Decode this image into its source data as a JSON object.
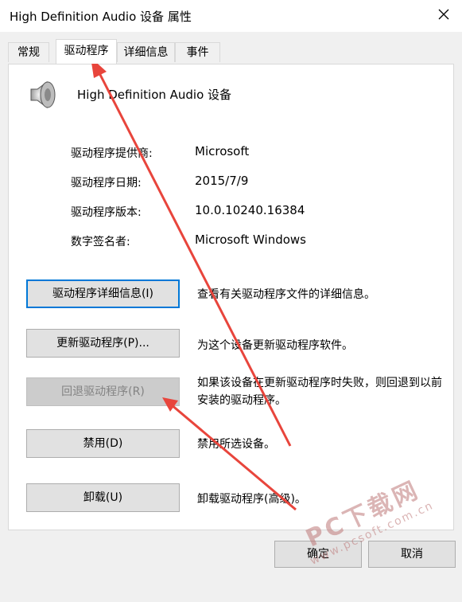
{
  "window": {
    "title": "High Definition Audio 设备 属性"
  },
  "tabs": [
    {
      "label": "常规"
    },
    {
      "label": "驱动程序"
    },
    {
      "label": "详细信息"
    },
    {
      "label": "事件"
    }
  ],
  "device": {
    "name": "High Definition Audio 设备",
    "icon": "speaker-icon"
  },
  "info": [
    {
      "label": "驱动程序提供商:",
      "value": "Microsoft"
    },
    {
      "label": "驱动程序日期:",
      "value": "2015/7/9"
    },
    {
      "label": "驱动程序版本:",
      "value": "10.0.10240.16384"
    },
    {
      "label": "数字签名者:",
      "value": "Microsoft Windows"
    }
  ],
  "actions": [
    {
      "label": "驱动程序详细信息(I)",
      "desc": "查看有关驱动程序文件的详细信息。"
    },
    {
      "label": "更新驱动程序(P)...",
      "desc": "为这个设备更新驱动程序软件。"
    },
    {
      "label": "回退驱动程序(R)",
      "desc": "如果该设备在更新驱动程序时失败，则回退到以前安装的驱动程序。"
    },
    {
      "label": "禁用(D)",
      "desc": "禁用所选设备。"
    },
    {
      "label": "卸载(U)",
      "desc": "卸载驱动程序(高级)。"
    }
  ],
  "footer": {
    "ok": "确定",
    "cancel": "取消"
  },
  "watermark": {
    "main": "PC下载网",
    "url": "www.pcsoft.com.cn"
  },
  "colors": {
    "annotation_arrow": "#e8453c",
    "focus": "#0078d7"
  }
}
